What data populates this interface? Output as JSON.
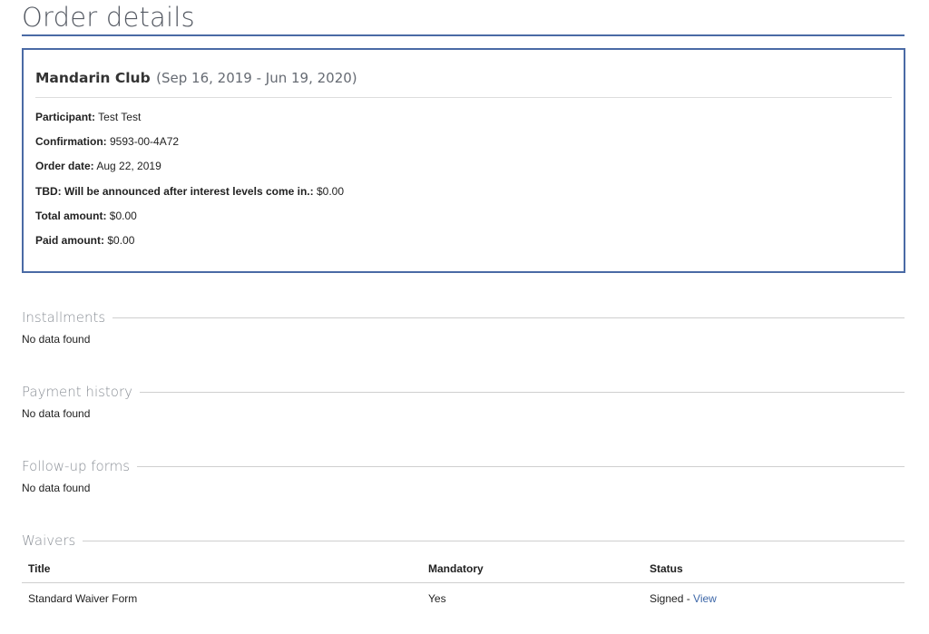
{
  "page": {
    "title": "Order details"
  },
  "order": {
    "club_name": "Mandarin Club",
    "club_dates": "(Sep 16, 2019 - Jun 19, 2020)",
    "fields": [
      {
        "label": "Participant:",
        "value": "Test Test"
      },
      {
        "label": "Confirmation:",
        "value": "9593-00-4A72"
      },
      {
        "label": "Order date:",
        "value": "Aug 22, 2019"
      },
      {
        "label": "TBD: Will be announced after interest levels come in.:",
        "value": "$0.00"
      },
      {
        "label": "Total amount:",
        "value": "$0.00"
      },
      {
        "label": "Paid amount:",
        "value": "$0.00"
      }
    ]
  },
  "sections": {
    "installments": {
      "title": "Installments",
      "empty_text": "No data found"
    },
    "payment_history": {
      "title": "Payment history",
      "empty_text": "No data found"
    },
    "followup_forms": {
      "title": "Follow-up forms",
      "empty_text": "No data found"
    },
    "waivers": {
      "title": "Waivers",
      "columns": {
        "title": "Title",
        "mandatory": "Mandatory",
        "status": "Status"
      },
      "rows": [
        {
          "title": "Standard Waiver Form",
          "mandatory": "Yes",
          "status": "Signed",
          "separator": " - ",
          "action": "View"
        }
      ]
    }
  },
  "colors": {
    "accent": "#4a6aa5",
    "link": "#3d67a8",
    "muted_heading": "#8a8f96"
  }
}
